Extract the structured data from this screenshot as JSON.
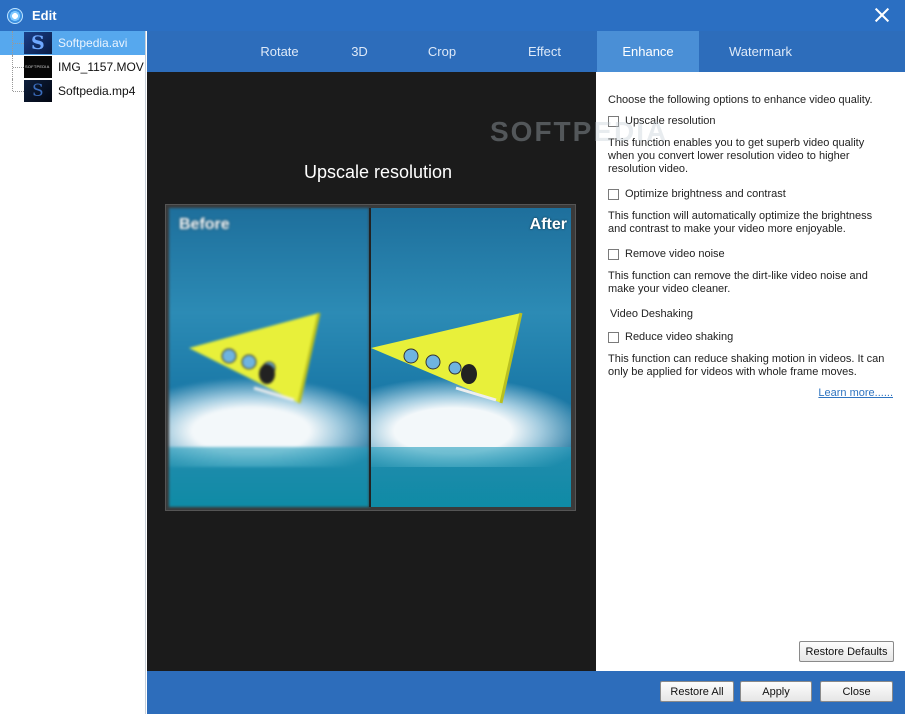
{
  "window": {
    "title": "Edit"
  },
  "files": [
    {
      "name": "Softpedia.avi",
      "selected": true
    },
    {
      "name": "IMG_1157.MOV",
      "selected": false
    },
    {
      "name": "Softpedia.mp4",
      "selected": false
    }
  ],
  "tabs": [
    {
      "label": "Rotate",
      "active": false
    },
    {
      "label": "3D",
      "active": false
    },
    {
      "label": "Crop",
      "active": false
    },
    {
      "label": "Effect",
      "active": false
    },
    {
      "label": "Enhance",
      "active": true
    },
    {
      "label": "Watermark",
      "active": false
    }
  ],
  "preview": {
    "title": "Upscale resolution",
    "before_label": "Before",
    "after_label": "After"
  },
  "enhance": {
    "intro": "Choose the following options to enhance video quality.",
    "upscale": {
      "label": "Upscale resolution",
      "checked": false,
      "desc": "This function enables you to get superb video quality when you convert lower resolution video to higher resolution video."
    },
    "brightness": {
      "label": "Optimize brightness and contrast",
      "checked": false,
      "desc": "This function will automatically optimize the brightness and contrast to make your video more enjoyable."
    },
    "noise": {
      "label": "Remove video noise",
      "checked": false,
      "desc": "This function can remove the dirt-like video noise and make your video cleaner."
    },
    "deshake_title": "Video Deshaking",
    "shaking": {
      "label": "Reduce video shaking",
      "checked": false,
      "desc": "This function can reduce shaking motion in videos. It can only be applied for videos with whole frame moves."
    },
    "learn_more": "Learn more......",
    "restore_defaults": "Restore Defaults"
  },
  "footer": {
    "restore_all": "Restore All",
    "apply": "Apply",
    "close": "Close"
  },
  "watermark": "SOFTPEDIA",
  "colors": {
    "titlebar": "#2b6fc2",
    "tabbar": "#2d6dbb",
    "tab_active": "#4a8fd6",
    "selected_file": "#56a8ee",
    "link": "#2f74c0"
  }
}
